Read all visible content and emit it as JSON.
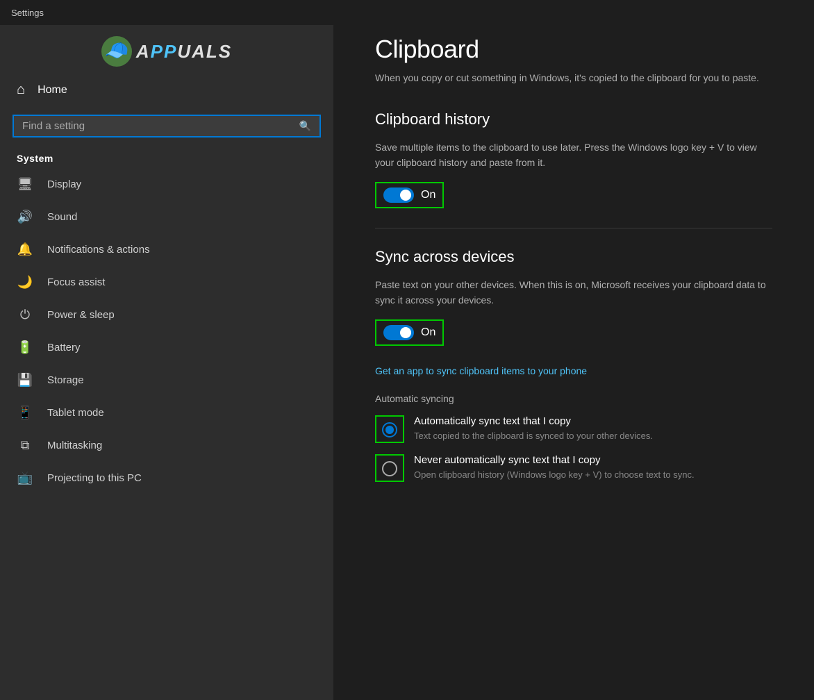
{
  "titleBar": {
    "label": "Settings"
  },
  "brand": {
    "name": "APPUALS",
    "logoEmoji": "🧢"
  },
  "home": {
    "label": "Home"
  },
  "search": {
    "placeholder": "Find a setting",
    "value": ""
  },
  "system": {
    "label": "System"
  },
  "navItems": [
    {
      "id": "display",
      "icon": "🖥",
      "label": "Display"
    },
    {
      "id": "sound",
      "icon": "🔊",
      "label": "Sound"
    },
    {
      "id": "notifications",
      "icon": "🔔",
      "label": "Notifications & actions"
    },
    {
      "id": "focus-assist",
      "icon": "🌙",
      "label": "Focus assist"
    },
    {
      "id": "power-sleep",
      "icon": "⏻",
      "label": "Power & sleep"
    },
    {
      "id": "battery",
      "icon": "🔋",
      "label": "Battery"
    },
    {
      "id": "storage",
      "icon": "💾",
      "label": "Storage"
    },
    {
      "id": "tablet-mode",
      "icon": "📱",
      "label": "Tablet mode"
    },
    {
      "id": "multitasking",
      "icon": "⧉",
      "label": "Multitasking"
    },
    {
      "id": "projecting",
      "icon": "📺",
      "label": "Projecting to this PC"
    }
  ],
  "main": {
    "pageTitle": "Clipboard",
    "pageDesc": "When you copy or cut something in Windows, it's copied to the clipboard for you to paste.",
    "clipboardHistory": {
      "sectionTitle": "Clipboard history",
      "sectionDesc": "Save multiple items to the clipboard to use later. Press the Windows logo key + V to view your clipboard history and paste from it.",
      "toggleState": "On"
    },
    "syncAcrossDevices": {
      "sectionTitle": "Sync across devices",
      "sectionDesc": "Paste text on your other devices. When this is on, Microsoft receives your clipboard data to sync it across your devices.",
      "toggleState": "On",
      "linkText": "Get an app to sync clipboard items to your phone",
      "autoSyncTitle": "Automatic syncing",
      "radioOptions": [
        {
          "id": "auto-sync",
          "label": "Automatically sync text that I copy",
          "desc": "Text copied to the clipboard is synced to your other devices.",
          "selected": true
        },
        {
          "id": "never-sync",
          "label": "Never automatically sync text that I copy",
          "desc": "Open clipboard history (Windows logo key + V) to choose text to sync.",
          "selected": false
        }
      ]
    }
  }
}
